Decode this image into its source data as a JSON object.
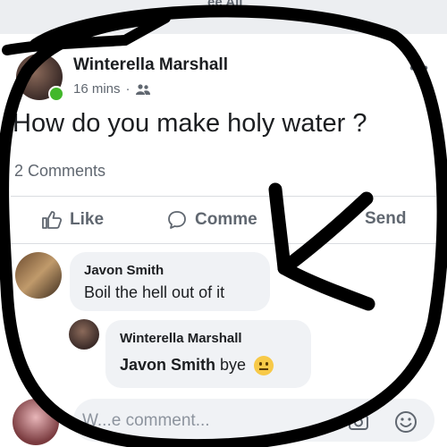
{
  "top_strip": {
    "text": "ee All"
  },
  "post": {
    "author": "Winterella Marshall",
    "time": "16 mins",
    "separator": "·",
    "audience_icon": "friends-icon",
    "text": "How do you make holy water ?",
    "comment_count": "2 Comments"
  },
  "actions": {
    "like": "Like",
    "comment": "Comme",
    "send": "Send"
  },
  "comments": [
    {
      "name": "Javon Smith",
      "text": "Boil the hell out of it"
    },
    {
      "name": "Winterella Marshall",
      "mention": "Javon Smith",
      "text": "bye",
      "emoji": "slightly-frowning-emoji"
    }
  ],
  "composer": {
    "placeholder": "W...e comment..."
  },
  "colors": {
    "facebook_gray": "#606770",
    "online_green": "#42b72a",
    "bubble": "#f0f2f5",
    "scribble": "#000000"
  }
}
